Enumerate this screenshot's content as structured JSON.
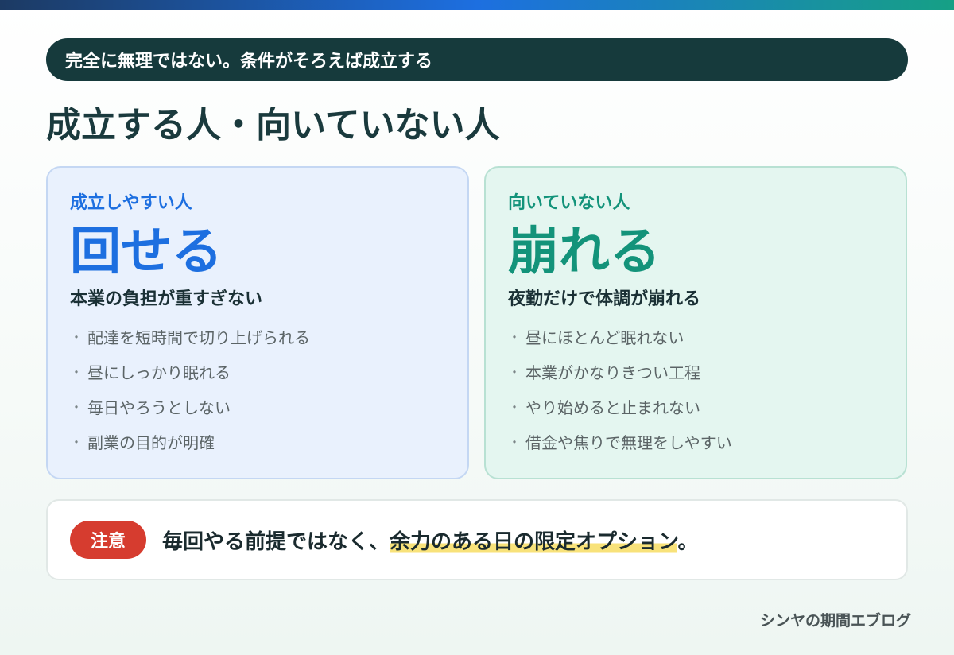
{
  "header": {
    "pill_text": "完全に無理ではない。条件がそろえば成立する",
    "title": "成立する人・向いていない人"
  },
  "cards": {
    "left": {
      "label": "成立しやすい人",
      "big": "回せる",
      "sub": "本業の負担が重すぎない",
      "bullets": [
        "配達を短時間で切り上げられる",
        "昼にしっかり眠れる",
        "毎日やろうとしない",
        "副業の目的が明確"
      ]
    },
    "right": {
      "label": "向いていない人",
      "big": "崩れる",
      "sub": "夜勤だけで体調が崩れる",
      "bullets": [
        "昼にほとんど眠れない",
        "本業がかなりきつい工程",
        "やり始めると止まれない",
        "借金や焦りで無理をしやすい"
      ]
    },
    "bullet_symbol": "・"
  },
  "note": {
    "badge": "注意",
    "text_before": "毎回やる前提ではなく、",
    "text_highlight": "余力のある日の限定オプション",
    "text_after": "。"
  },
  "footer": {
    "brand": "シンヤの期間エブログ"
  },
  "colors": {
    "accent_blue": "#1d6fe0",
    "accent_green": "#13937a",
    "dark_teal": "#163a3c",
    "warning_red": "#d63c2f",
    "highlight_yellow": "#f8e27a"
  }
}
